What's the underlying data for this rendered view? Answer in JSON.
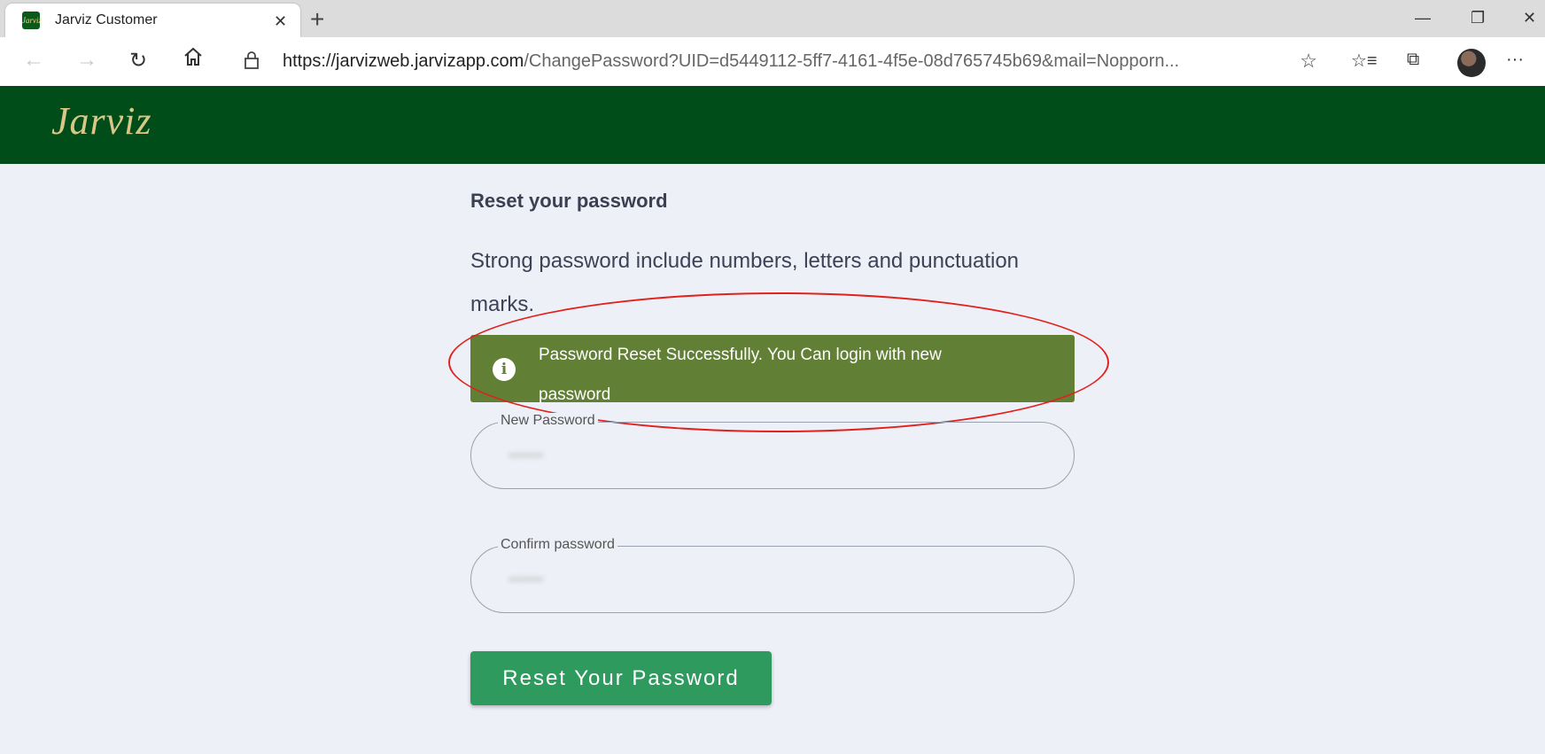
{
  "browser": {
    "tab_title": "Jarviz Customer",
    "tab_close": "✕",
    "new_tab": "+",
    "url_host": "https://jarvizweb.jarvizapp.com",
    "url_rest": "/ChangePassword?UID=d5449112-5ff7-4161-4f5e-08d765745b69&mail=Nopporn...",
    "favicon_text": "Jarviz",
    "icons": {
      "back": "back-arrow-icon",
      "forward": "forward-arrow-icon",
      "refresh": "refresh-icon",
      "home": "home-icon",
      "lock": "lock-icon",
      "favorite": "star-icon",
      "favorites_list": "favorites-icon",
      "collections": "collections-icon",
      "more": "more-icon"
    }
  },
  "site": {
    "logo": "Jarviz",
    "brand_color": "#004d19"
  },
  "form": {
    "heading": "Reset your password",
    "hint": "Strong password include numbers, letters and punctuation marks.",
    "alert_text": "Password Reset Successfully. You Can login with new password",
    "alert_color": "#617f35",
    "new_password_label": "New Password",
    "new_password_value": "•••••••",
    "confirm_password_label": "Confirm password",
    "confirm_password_value": "•••••••",
    "submit_label": "Reset Your Password",
    "submit_color": "#2e9a5e"
  },
  "annotation": {
    "highlight_color": "#e2201c"
  }
}
